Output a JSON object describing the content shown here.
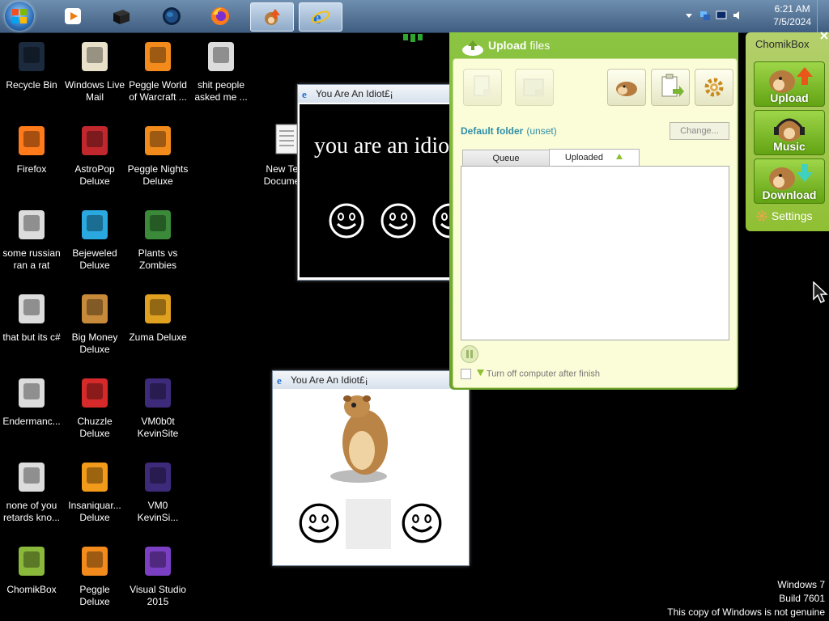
{
  "taskbar": {
    "start_icon": "windows-orb-icon",
    "pinned": [
      {
        "icon": "media-player-icon"
      },
      {
        "icon": "app-black-box-icon"
      },
      {
        "icon": "globe-icon"
      },
      {
        "icon": "firefox-icon"
      },
      {
        "icon": "chomikbox-icon",
        "active": true
      },
      {
        "icon": "internet-explorer-icon",
        "active": true
      }
    ],
    "clock_time": "6:21 AM",
    "clock_date": "7/5/2024"
  },
  "desktop_icons": [
    {
      "label": "Recycle Bin",
      "icon": "recycle-bin-icon"
    },
    {
      "label": "Windows Live Mail",
      "icon": "windows-live-mail-icon"
    },
    {
      "label": "Peggle World of Warcraft ...",
      "icon": "peggle-icon"
    },
    {
      "label": "shit people asked me ...",
      "icon": "file-icon"
    },
    {
      "label": "Firefox",
      "icon": "firefox-icon"
    },
    {
      "label": "AstroPop Deluxe",
      "icon": "astropop-icon"
    },
    {
      "label": "Peggle Nights Deluxe",
      "icon": "peggle-icon"
    },
    {
      "label": "some russian ran a rat",
      "icon": "file-icon"
    },
    {
      "label": "Bejeweled Deluxe",
      "icon": "bejeweled-icon"
    },
    {
      "label": "Plants vs Zombies",
      "icon": "plants-vs-zombies-icon"
    },
    {
      "label": "that but its c#",
      "icon": "file-icon"
    },
    {
      "label": "Big Money Deluxe",
      "icon": "big-money-icon"
    },
    {
      "label": "Zuma Deluxe",
      "icon": "zuma-icon"
    },
    {
      "label": "Endermanc...",
      "icon": "file-icon"
    },
    {
      "label": "Chuzzle Deluxe",
      "icon": "chuzzle-icon"
    },
    {
      "label": "VM0b0t KevinSite",
      "icon": "visual-studio-file-icon"
    },
    {
      "label": "none of you retards kno...",
      "icon": "file-icon"
    },
    {
      "label": "Insaniquar... Deluxe",
      "icon": "insaniquarium-icon"
    },
    {
      "label": "VM0 KevinSi...",
      "icon": "visual-studio-file-icon"
    },
    {
      "label": "ChomikBox",
      "icon": "chomikbox-icon"
    },
    {
      "label": "Peggle Deluxe",
      "icon": "peggle-icon"
    },
    {
      "label": "Visual Studio 2015",
      "icon": "visual-studio-icon"
    },
    {
      "label": "New Text Document",
      "icon": "text-document-icon"
    }
  ],
  "idiot_window_1": {
    "title": "You Are An Idiot£¡",
    "text": "you are an idiot"
  },
  "idiot_window_2": {
    "title": "You Are An Idiot£¡"
  },
  "chomikbox": {
    "header_bold": "Upload",
    "header_rest": "files",
    "default_folder_label": "Default folder",
    "default_folder_value": "(unset)",
    "change_button": "Change...",
    "tabs": [
      "Queue",
      "Uploaded"
    ],
    "turn_off_label": "Turn off computer after finish",
    "side_title": "ChomikBox",
    "side_buttons": [
      "Upload",
      "Music",
      "Download"
    ],
    "settings_label": "Settings"
  },
  "watermark": {
    "line1": "Windows 7",
    "line2": "Build 7601",
    "line3": "This copy of Windows is not genuine"
  }
}
